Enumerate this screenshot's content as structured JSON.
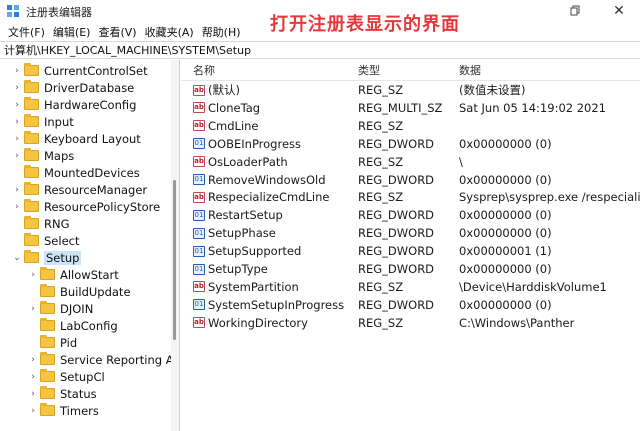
{
  "window": {
    "title": "注册表编辑器",
    "caption_overlay": "打开注册表显示的界面"
  },
  "menu": [
    "文件(F)",
    "编辑(E)",
    "查看(V)",
    "收藏夹(A)",
    "帮助(H)"
  ],
  "address": "计算机\\HKEY_LOCAL_MACHINE\\SYSTEM\\Setup",
  "tree": [
    {
      "label": "CurrentControlSet",
      "expander": "›",
      "level": 1
    },
    {
      "label": "DriverDatabase",
      "expander": "›",
      "level": 1
    },
    {
      "label": "HardwareConfig",
      "expander": "›",
      "level": 1
    },
    {
      "label": "Input",
      "expander": "›",
      "level": 1
    },
    {
      "label": "Keyboard Layout",
      "expander": "›",
      "level": 1
    },
    {
      "label": "Maps",
      "expander": "›",
      "level": 1
    },
    {
      "label": "MountedDevices",
      "expander": "",
      "level": 1
    },
    {
      "label": "ResourceManager",
      "expander": "›",
      "level": 1
    },
    {
      "label": "ResourcePolicyStore",
      "expander": "›",
      "level": 1
    },
    {
      "label": "RNG",
      "expander": "",
      "level": 1
    },
    {
      "label": "Select",
      "expander": "",
      "level": 1
    },
    {
      "label": "Setup",
      "expander": "⌄",
      "level": 1,
      "selected": true
    },
    {
      "label": "AllowStart",
      "expander": "›",
      "level": 2
    },
    {
      "label": "BuildUpdate",
      "expander": "",
      "level": 2
    },
    {
      "label": "DJOIN",
      "expander": "›",
      "level": 2
    },
    {
      "label": "LabConfig",
      "expander": "",
      "level": 2
    },
    {
      "label": "Pid",
      "expander": "",
      "level": 2
    },
    {
      "label": "Service Reporting API",
      "expander": "›",
      "level": 2
    },
    {
      "label": "SetupCl",
      "expander": "›",
      "level": 2
    },
    {
      "label": "Status",
      "expander": "›",
      "level": 2
    },
    {
      "label": "Timers",
      "expander": "›",
      "level": 2
    }
  ],
  "columns": {
    "name": "名称",
    "type": "类型",
    "data": "数据"
  },
  "values": [
    {
      "name": "(默认)",
      "type": "REG_SZ",
      "data": "(数值未设置)",
      "icon": "sz"
    },
    {
      "name": "CloneTag",
      "type": "REG_MULTI_SZ",
      "data": "Sat Jun 05 14:19:02 2021",
      "icon": "sz"
    },
    {
      "name": "CmdLine",
      "type": "REG_SZ",
      "data": "",
      "icon": "sz"
    },
    {
      "name": "OOBEInProgress",
      "type": "REG_DWORD",
      "data": "0x00000000 (0)",
      "icon": "dw"
    },
    {
      "name": "OsLoaderPath",
      "type": "REG_SZ",
      "data": "\\",
      "icon": "sz"
    },
    {
      "name": "RemoveWindowsOld",
      "type": "REG_DWORD",
      "data": "0x00000000 (0)",
      "icon": "dw"
    },
    {
      "name": "RespecializeCmdLine",
      "type": "REG_SZ",
      "data": "Sysprep\\sysprep.exe /respecialize /",
      "icon": "sz"
    },
    {
      "name": "RestartSetup",
      "type": "REG_DWORD",
      "data": "0x00000000 (0)",
      "icon": "dw"
    },
    {
      "name": "SetupPhase",
      "type": "REG_DWORD",
      "data": "0x00000000 (0)",
      "icon": "dw"
    },
    {
      "name": "SetupSupported",
      "type": "REG_DWORD",
      "data": "0x00000001 (1)",
      "icon": "dw"
    },
    {
      "name": "SetupType",
      "type": "REG_DWORD",
      "data": "0x00000000 (0)",
      "icon": "dw"
    },
    {
      "name": "SystemPartition",
      "type": "REG_SZ",
      "data": "\\Device\\HarddiskVolume1",
      "icon": "sz"
    },
    {
      "name": "SystemSetupInProgress",
      "type": "REG_DWORD",
      "data": "0x00000000 (0)",
      "icon": "dw"
    },
    {
      "name": "WorkingDirectory",
      "type": "REG_SZ",
      "data": "C:\\Windows\\Panther",
      "icon": "sz"
    }
  ],
  "icons": {
    "sz_glyph": "ab",
    "dw_glyph": "01"
  }
}
